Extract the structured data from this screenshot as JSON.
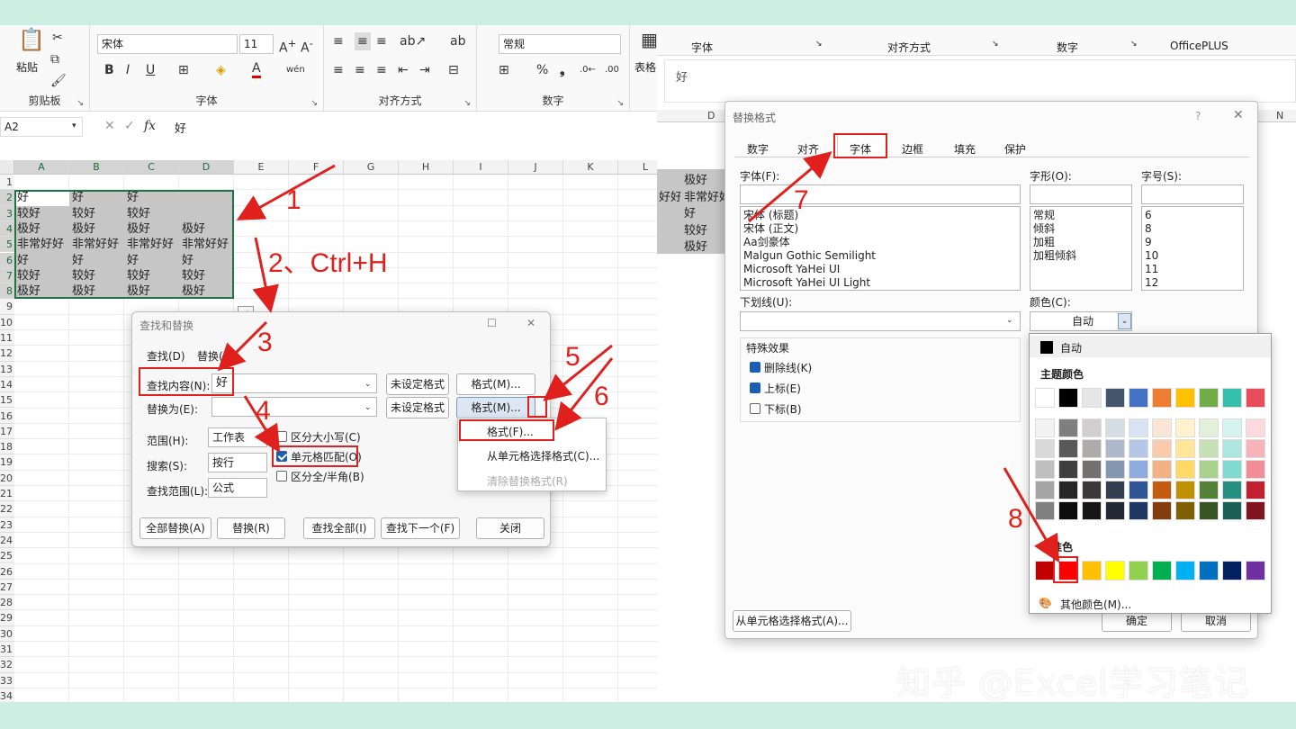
{
  "ribbon": {
    "clipboard": {
      "paste": "粘贴",
      "group": "剪贴板"
    },
    "font": {
      "name": "宋体",
      "size": "11",
      "group": "字体"
    },
    "align": {
      "group": "对齐方式"
    },
    "number": {
      "format": "常规",
      "group": "数字"
    },
    "table": {
      "label": "表格"
    }
  },
  "formula_bar": {
    "namebox": "A2",
    "fx": "fx",
    "content": "好"
  },
  "sheet": {
    "columns": [
      "A",
      "B",
      "C",
      "D",
      "E",
      "F",
      "G",
      "H",
      "I",
      "J",
      "K",
      "L"
    ],
    "rows": [
      "1",
      "2",
      "3",
      "4",
      "5",
      "6",
      "7",
      "8",
      "9",
      "10",
      "11",
      "12",
      "13",
      "14",
      "15",
      "16",
      "17",
      "18",
      "19",
      "20",
      "21",
      "22",
      "23",
      "24",
      "25",
      "26",
      "27",
      "28",
      "29",
      "30",
      "31",
      "32",
      "33",
      "34"
    ],
    "data": [
      [
        "好",
        "好",
        "好",
        ""
      ],
      [
        "较好",
        "较好",
        "较好",
        ""
      ],
      [
        "极好",
        "极好",
        "极好",
        "极好"
      ],
      [
        "非常好好",
        "非常好好",
        "非常好好",
        "非常好好"
      ],
      [
        "好",
        "好",
        "好",
        "好"
      ],
      [
        "较好",
        "较好",
        "较好",
        "较好"
      ],
      [
        "极好",
        "极好",
        "极好",
        "极好"
      ]
    ]
  },
  "find_replace": {
    "title": "查找和替换",
    "tab_find": "查找(D)",
    "tab_replace": "替换(P)",
    "find_label": "查找内容(N):",
    "find_value": "好",
    "replace_label": "替换为(E):",
    "replace_value": "",
    "no_format": "未设定格式",
    "format_btn": "格式(M)...",
    "scope_label": "范围(H):",
    "scope_value": "工作表",
    "search_label": "搜索(S):",
    "search_value": "按行",
    "lookin_label": "查找范围(L):",
    "lookin_value": "公式",
    "match_case": "区分大小写(C)",
    "match_cell": "单元格匹配(O)",
    "match_width": "区分全/半角(B)",
    "replace_all": "全部替换(A)",
    "replace": "替换(R)",
    "find_all": "查找全部(I)",
    "find_next": "查找下一个(F)",
    "close": "关闭",
    "menu": [
      "格式(F)...",
      "从单元格选择格式(C)...",
      "清除替换格式(R)"
    ]
  },
  "annotations": {
    "n1": "1",
    "n2": "2、Ctrl+H",
    "n3": "3",
    "n4": "4",
    "n5": "5",
    "n6": "6",
    "n7": "7",
    "n8": "8"
  },
  "right_ribbon": {
    "font": "字体",
    "align": "对齐方式",
    "number": "数字",
    "officeplus": "OfficePLUS"
  },
  "right_formula": {
    "content": "好"
  },
  "right_sheet": {
    "col_d": "D",
    "col_n": "N",
    "cells": [
      "极好",
      "非常好好",
      "好",
      "较好",
      "极好"
    ],
    "left_cells": [
      "",
      "好好",
      "",
      "",
      ""
    ]
  },
  "format_cells": {
    "title": "替换格式",
    "tabs": [
      "数字",
      "对齐",
      "字体",
      "边框",
      "填充",
      "保护"
    ],
    "font_label": "字体(F):",
    "fonts": [
      "宋体 (标题)",
      "宋体 (正文)",
      "Aa剑豪体",
      "Malgun Gothic Semilight",
      "Microsoft YaHei UI",
      "Microsoft YaHei UI Light"
    ],
    "style_label": "字形(O):",
    "styles": [
      "常规",
      "倾斜",
      "加粗",
      "加粗倾斜"
    ],
    "size_label": "字号(S):",
    "sizes": [
      "6",
      "8",
      "9",
      "10",
      "11",
      "12"
    ],
    "underline_label": "下划线(U):",
    "color_label": "颜色(C):",
    "color_value": "自动",
    "effects_label": "特殊效果",
    "strike": "删除线(K)",
    "superscript": "上标(E)",
    "subscript": "下标(B)",
    "from_cell": "从单元格选择格式(A)...",
    "ok": "确定",
    "cancel": "取消",
    "help": "?",
    "close": "✕"
  },
  "color_picker": {
    "auto": "自动",
    "theme_label": "主题颜色",
    "theme_top": [
      "#ffffff",
      "#000000",
      "#e7e6e6",
      "#44546a",
      "#4472c4",
      "#ed7d31",
      "#ffc000",
      "#70ad47",
      "#35bfad",
      "#e84c5a"
    ],
    "theme_shades": [
      [
        "#f2f2f2",
        "#7f7f7f",
        "#d0cece",
        "#d6dce4",
        "#dae3f3",
        "#fbe5d6",
        "#fff2cc",
        "#e2f0d9",
        "#d5f3ef",
        "#fbd9dc"
      ],
      [
        "#d9d9d9",
        "#595959",
        "#aeabab",
        "#adb9ca",
        "#b4c7e7",
        "#f8cbad",
        "#ffe699",
        "#c5e0b4",
        "#abe7df",
        "#f6b3b9"
      ],
      [
        "#bfbfbf",
        "#3f3f3f",
        "#757070",
        "#8497b0",
        "#8faadc",
        "#f4b183",
        "#ffd966",
        "#a9d18e",
        "#7fdbcf",
        "#f28d97"
      ],
      [
        "#a6a6a6",
        "#262626",
        "#3a3838",
        "#333f50",
        "#2f5597",
        "#c55a11",
        "#bf9000",
        "#538135",
        "#258f81",
        "#c0202f"
      ],
      [
        "#808080",
        "#0d0d0d",
        "#171616",
        "#222a35",
        "#203864",
        "#843c0c",
        "#7f6000",
        "#375623",
        "#185f56",
        "#80151f"
      ]
    ],
    "standard_label": "标准色",
    "standard": [
      "#c00000",
      "#ff0000",
      "#ffc000",
      "#ffff00",
      "#92d050",
      "#00b050",
      "#00b0f0",
      "#0070c0",
      "#002060",
      "#7030a0"
    ],
    "more": "其他颜色(M)..."
  },
  "watermark": "知乎 @Excel学习笔记",
  "colors": {
    "accent_red": "#e0201d",
    "select_gray": "#c6c6c6",
    "excel_green": "#217346"
  }
}
